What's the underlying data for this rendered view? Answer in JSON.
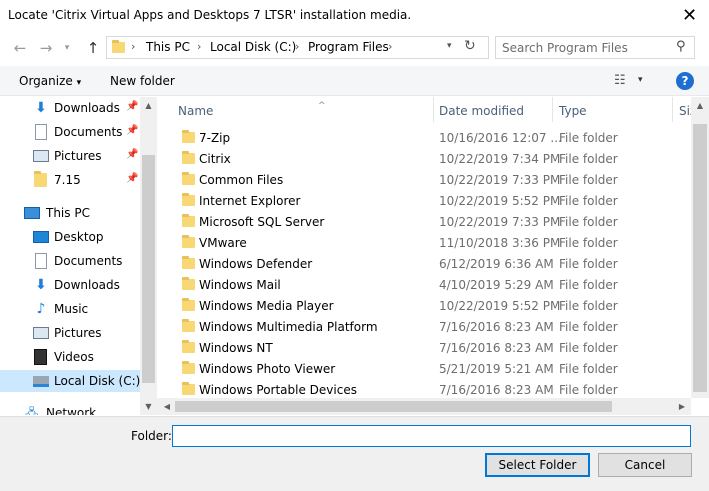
{
  "window": {
    "title": "Locate 'Citrix Virtual Apps and Desktops 7 LTSR' installation media."
  },
  "address": {
    "breadcrumbs": [
      "This PC",
      "Local Disk (C:)",
      "Program Files"
    ],
    "search_placeholder": "Search Program Files"
  },
  "toolbar": {
    "organize_label": "Organize",
    "new_folder_label": "New folder"
  },
  "icons": {
    "back": "back-arrow-icon",
    "forward": "forward-arrow-icon",
    "recent": "chevron-down-icon",
    "up": "up-arrow-icon",
    "refresh": "refresh-icon",
    "search": "search-icon",
    "view": "view-options-icon",
    "help": "help-icon",
    "close": "close-icon",
    "folder": "folder-icon"
  },
  "colors": {
    "accent": "#0078d7",
    "selection": "#cce8ff",
    "folder": "#f8d775"
  },
  "nav": {
    "quick_access": [
      {
        "label": "Downloads",
        "icon": "download-icon"
      },
      {
        "label": "Documents",
        "icon": "documents-icon"
      },
      {
        "label": "Pictures",
        "icon": "pictures-icon"
      },
      {
        "label": "7.15",
        "icon": "folder-icon"
      }
    ],
    "this_pc_label": "This PC",
    "this_pc_items": [
      {
        "label": "Desktop",
        "icon": "desktop-icon"
      },
      {
        "label": "Documents",
        "icon": "documents-icon"
      },
      {
        "label": "Downloads",
        "icon": "download-icon"
      },
      {
        "label": "Music",
        "icon": "music-icon"
      },
      {
        "label": "Pictures",
        "icon": "pictures-icon"
      },
      {
        "label": "Videos",
        "icon": "videos-icon"
      },
      {
        "label": "Local Disk (C:)",
        "icon": "drive-icon"
      }
    ],
    "network_label": "Network"
  },
  "columns": {
    "name": "Name",
    "date_modified": "Date modified",
    "type": "Type",
    "size": "Size"
  },
  "files": [
    {
      "name": "7-Zip",
      "date": "10/16/2016 12:07 ...",
      "type": "File folder"
    },
    {
      "name": "Citrix",
      "date": "10/22/2019 7:34 PM",
      "type": "File folder"
    },
    {
      "name": "Common Files",
      "date": "10/22/2019 7:33 PM",
      "type": "File folder"
    },
    {
      "name": "Internet Explorer",
      "date": "10/22/2019 5:52 PM",
      "type": "File folder"
    },
    {
      "name": "Microsoft SQL Server",
      "date": "10/22/2019 7:33 PM",
      "type": "File folder"
    },
    {
      "name": "VMware",
      "date": "11/10/2018 3:36 PM",
      "type": "File folder"
    },
    {
      "name": "Windows Defender",
      "date": "6/12/2019 6:36 AM",
      "type": "File folder"
    },
    {
      "name": "Windows Mail",
      "date": "4/10/2019 5:29 AM",
      "type": "File folder"
    },
    {
      "name": "Windows Media Player",
      "date": "10/22/2019 5:52 PM",
      "type": "File folder"
    },
    {
      "name": "Windows Multimedia Platform",
      "date": "7/16/2016 8:23 AM",
      "type": "File folder"
    },
    {
      "name": "Windows NT",
      "date": "7/16/2016 8:23 AM",
      "type": "File folder"
    },
    {
      "name": "Windows Photo Viewer",
      "date": "5/21/2019 5:21 AM",
      "type": "File folder"
    },
    {
      "name": "Windows Portable Devices",
      "date": "7/16/2016 8:23 AM",
      "type": "File folder"
    }
  ],
  "footer": {
    "folder_label": "Folder:",
    "folder_value": "",
    "select_label": "Select Folder",
    "cancel_label": "Cancel"
  }
}
